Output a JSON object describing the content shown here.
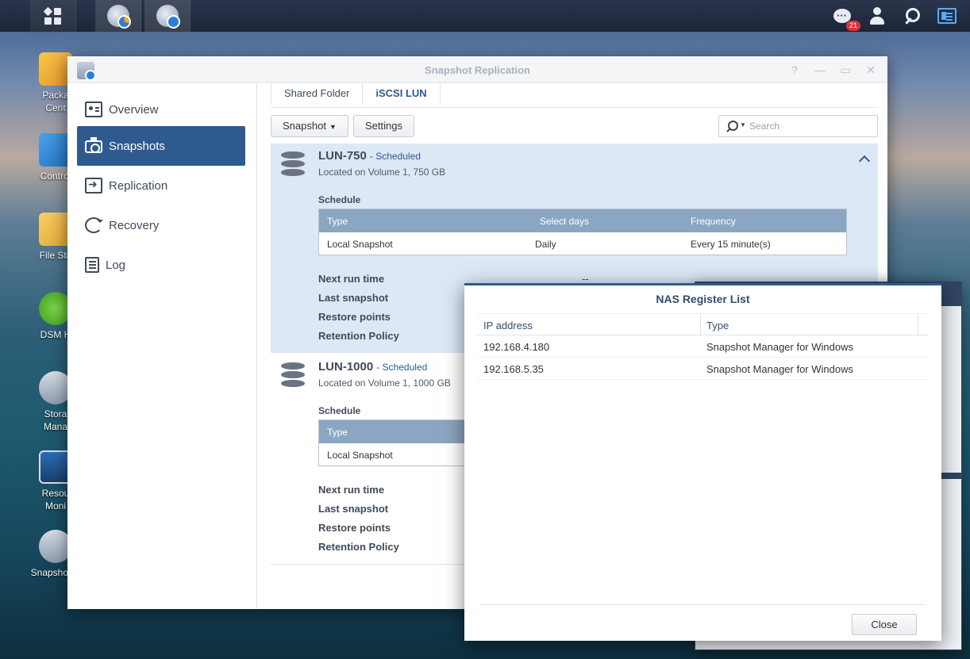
{
  "taskbar": {
    "notification_count": "21"
  },
  "desktop_icons": [
    {
      "label_line1": "Packa",
      "label_line2": "Cent"
    },
    {
      "label_line1": "Control",
      "label_line2": ""
    },
    {
      "label_line1": "File Sta",
      "label_line2": ""
    },
    {
      "label_line1": "DSM H",
      "label_line2": ""
    },
    {
      "label_line1": "Stora",
      "label_line2": "Mana"
    },
    {
      "label_line1": "Resou",
      "label_line2": "Moni"
    },
    {
      "label_line1": "Snapshot R",
      "label_line2": ""
    }
  ],
  "window": {
    "title": "Snapshot Replication",
    "controls": {
      "help": "?",
      "minimize": "—",
      "maximize": "▭",
      "close": "✕"
    }
  },
  "sidebar": {
    "items": [
      {
        "label": "Overview"
      },
      {
        "label": "Snapshots"
      },
      {
        "label": "Replication"
      },
      {
        "label": "Recovery"
      },
      {
        "label": "Log"
      }
    ]
  },
  "tabs": [
    {
      "label": "Shared Folder"
    },
    {
      "label": "iSCSI LUN"
    }
  ],
  "toolbar": {
    "snapshot_label": "Snapshot",
    "settings_label": "Settings",
    "search_placeholder": "Search"
  },
  "luns": [
    {
      "name": "LUN-750",
      "dash": "- ",
      "status": "Scheduled",
      "location": "Located on Volume 1, 750 GB",
      "schedule_label": "Schedule",
      "schedule_headers": [
        "Type",
        "Select days",
        "Frequency"
      ],
      "schedule_row": [
        "Local Snapshot",
        "Daily",
        "Every 15 minute(s)"
      ],
      "info_labels": [
        "Next run time",
        "Last snapshot",
        "Restore points",
        "Retention Policy"
      ],
      "next_run_value": "--"
    },
    {
      "name": "LUN-1000",
      "dash": "- ",
      "status": "Scheduled",
      "location": "Located on Volume 1, 1000 GB",
      "schedule_label": "Schedule",
      "schedule_headers": [
        "Type"
      ],
      "schedule_row": [
        "Local Snapshot"
      ],
      "info_labels": [
        "Next run time",
        "Last snapshot",
        "Restore points",
        "Retention Policy"
      ]
    }
  ],
  "modal": {
    "title": "NAS Register List",
    "headers": [
      "IP address",
      "Type"
    ],
    "rows": [
      {
        "ip": "192.168.4.180",
        "type": "Snapshot Manager for Windows"
      },
      {
        "ip": "192.168.5.35",
        "type": "Snapshot Manager for Windows"
      }
    ],
    "close_label": "Close"
  },
  "colors": {
    "accent": "#2f5a8f",
    "table_header": "#8ba6c2",
    "selected_row": "#dce8f6"
  }
}
